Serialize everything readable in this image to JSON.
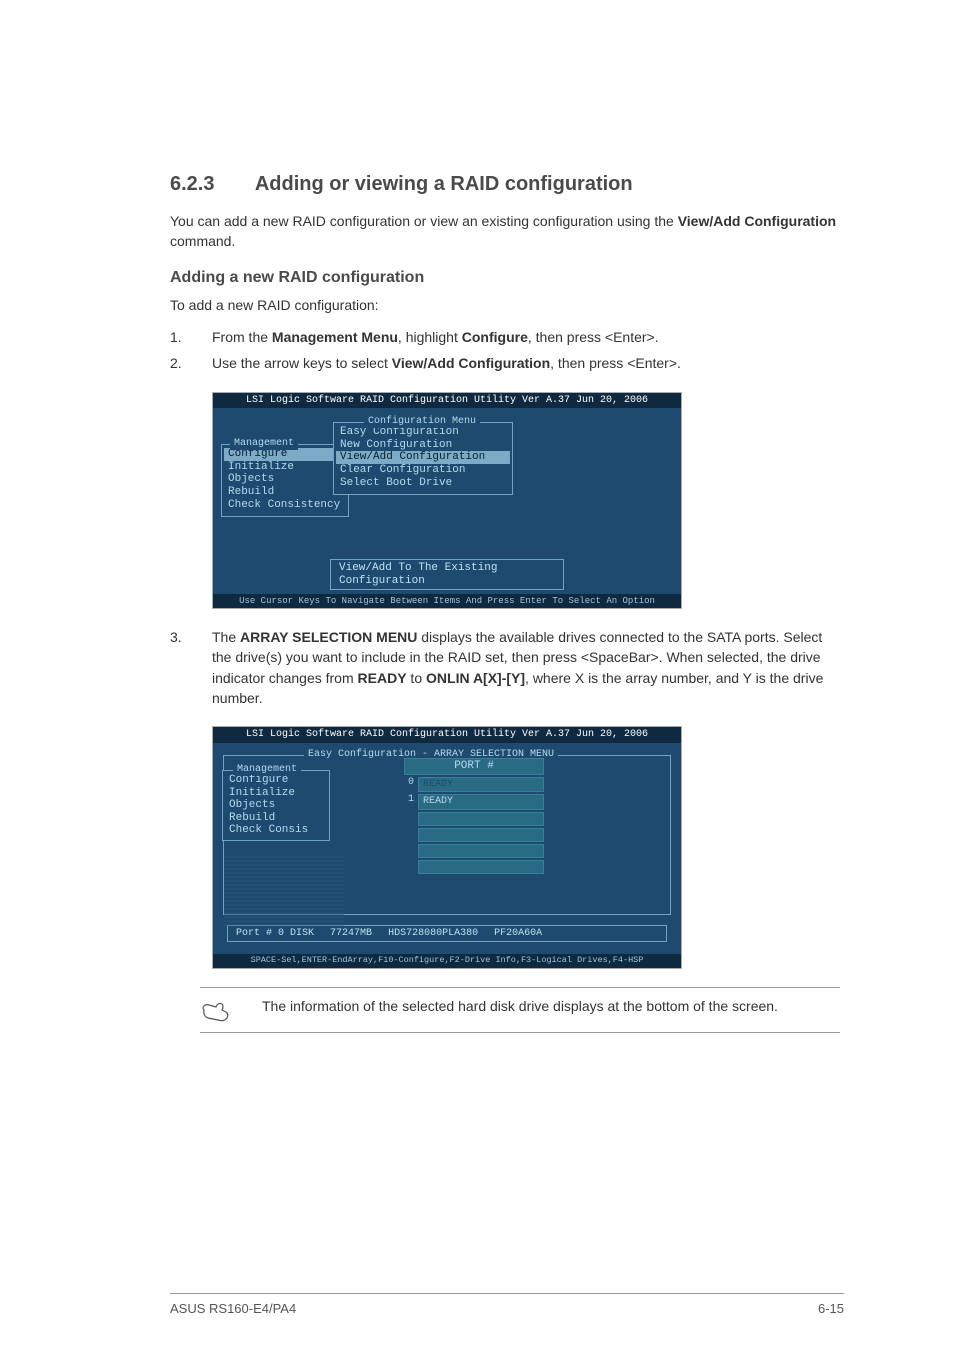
{
  "heading_num": "6.2.3",
  "heading_title": "Adding or viewing a RAID configuration",
  "intro_a": "You can add a new RAID configuration or view an existing configuration using the ",
  "intro_b_bold": "View/Add Configuration",
  "intro_c": " command.",
  "sub_heading": "Adding a new RAID configuration",
  "sub_intro": "To add a new RAID configuration:",
  "step1_a": "From the ",
  "step1_b": "Management Menu",
  "step1_c": ", highlight ",
  "step1_d": "Configure",
  "step1_e": ", then press <Enter>.",
  "step2_a": "Use the arrow keys to select ",
  "step2_b": "View/Add Configuration",
  "step2_c": ", then press <Enter>.",
  "shot_title": "LSI Logic Software RAID Configuration Utility Ver A.37 Jun 20, 2006",
  "cfg_menu": {
    "title": "Configuration Menu",
    "items": [
      "Easy Configuration",
      "New Configuration",
      "View/Add Configuration",
      "Clear Configuration",
      "Select Boot Drive"
    ]
  },
  "mgmt_menu": {
    "title": "Management",
    "items": [
      "Configure",
      "Initialize",
      "Objects",
      "Rebuild",
      "Check Consistency"
    ]
  },
  "hint_text": "View/Add To The Existing Configuration",
  "foot_text1": "Use Cursor Keys To Navigate Between Items And Press Enter To Select An Option",
  "step3_a": "The ",
  "step3_b": "ARRAY SELECTION MENU",
  "step3_c": " displays the available drives connected to the SATA ports. Select the drive(s) you want to include in the RAID set, then press <SpaceBar>. When selected, the drive indicator changes from ",
  "step3_d": "READY",
  "step3_e": " to ",
  "step3_f": "ONLIN A[X]-[Y]",
  "step3_g": ", where X is the array number, and Y is the drive number.",
  "arrsel_title": "Easy Configuration - ARRAY SELECTION MENU",
  "mgmt2_title": "Management",
  "mgmt2_items": [
    "Configure",
    "Initialize",
    "Objects",
    "Rebuild",
    "Check Consis"
  ],
  "port_hdr": "PORT #",
  "drives": [
    {
      "idx": "0",
      "status": "READY"
    },
    {
      "idx": "1",
      "status": "READY"
    }
  ],
  "drive_info": {
    "col1": "Port #  0 DISK",
    "col2": "77247MB",
    "col3": "HDS728080PLA380",
    "col4": "PF20A60A"
  },
  "foot_text2": "SPACE-Sel,ENTER-EndArray,F10-Configure,F2-Drive Info,F3-Logical Drives,F4-HSP",
  "note_text": "The information of the selected hard disk drive displays at the bottom of the screen.",
  "footer_left": "ASUS RS160-E4/PA4",
  "footer_right": "6-15"
}
